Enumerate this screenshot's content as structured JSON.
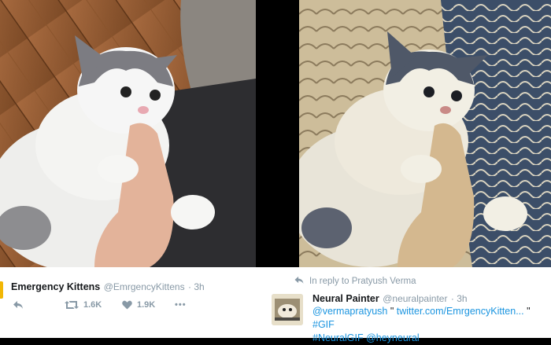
{
  "left_tweet": {
    "name": "Emergency Kittens",
    "handle": "@EmrgencyKittens",
    "time": "· 3h",
    "retweets": "1.6K",
    "likes": "1.9K",
    "more": "•••"
  },
  "right_tweet": {
    "reply_context": "In reply to Pratyush Verma",
    "name": "Neural Painter",
    "handle": "@neuralpainter",
    "time": "· 3h",
    "text_mention": "@vermapratyush",
    "text_quote_open": " \" ",
    "text_link": "twitter.com/EmrgencyKitten...",
    "text_quote_close": " \" ",
    "text_tag1": "#GIF",
    "text_tag2": "#NeuralGIF",
    "text_mention2": "@heyneural"
  },
  "colors": {
    "link": "#1b95e0",
    "muted": "#8899a6",
    "text": "#14171a"
  }
}
